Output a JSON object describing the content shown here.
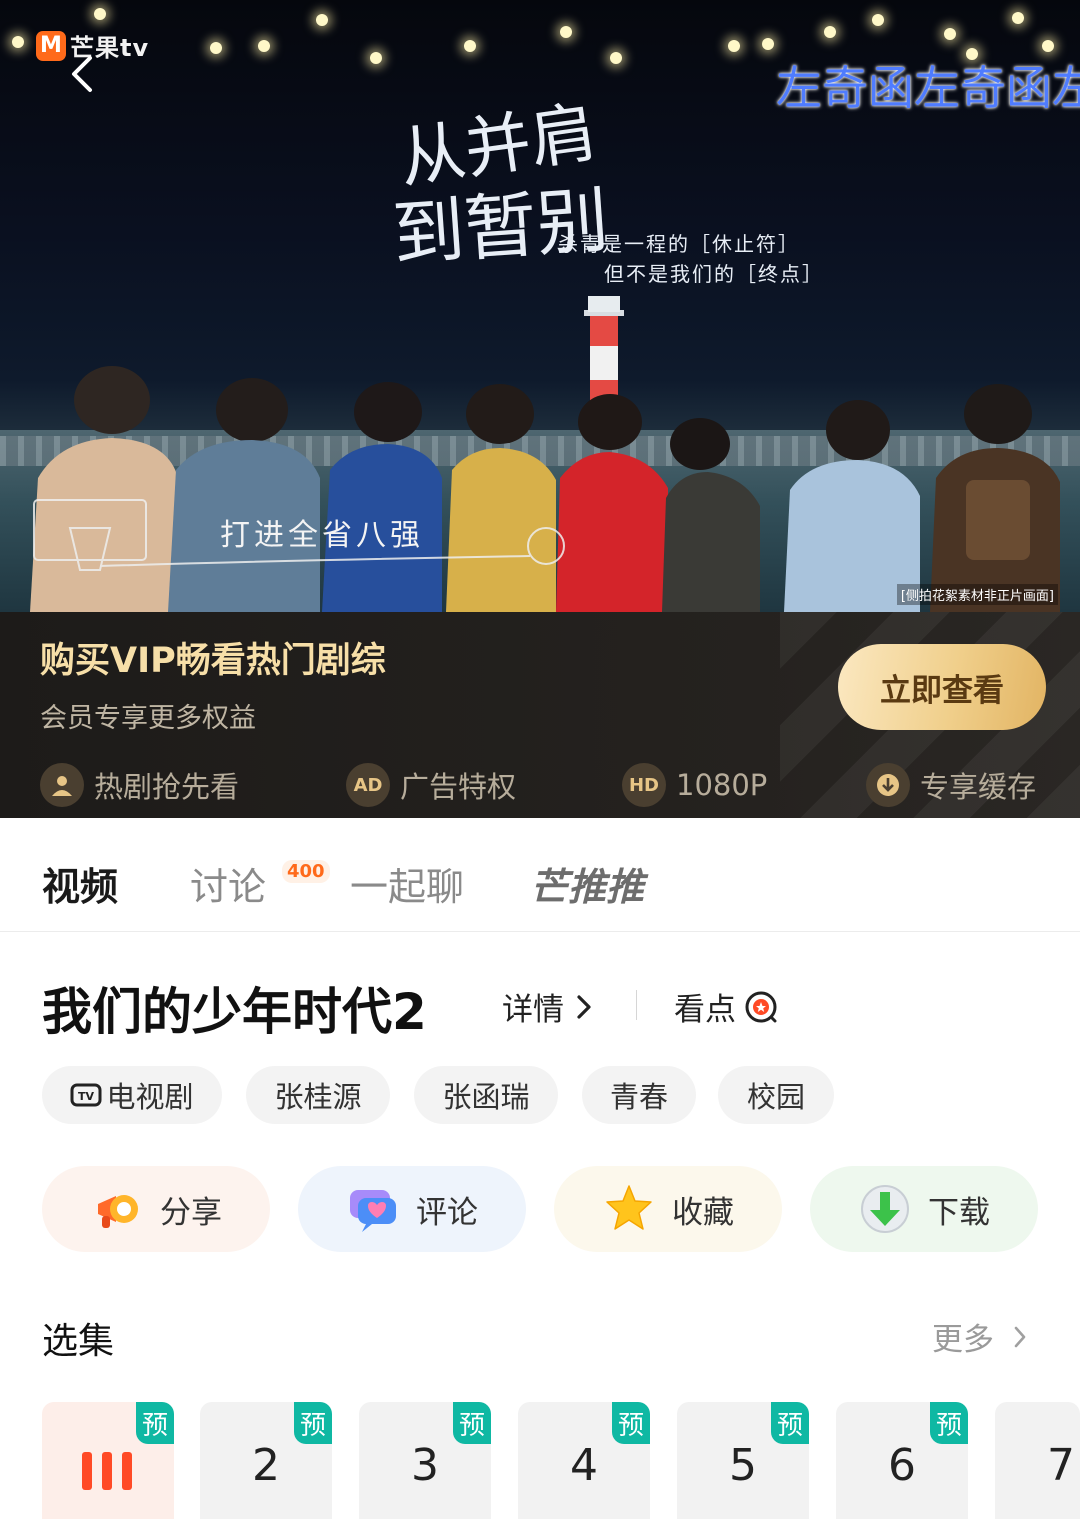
{
  "player": {
    "logo_text": "芒果tv",
    "marquee": "左奇函左奇函左",
    "calligraphy_line1": "从并肩",
    "calligraphy_line2": "到暂别",
    "calligraphy_sub1": "杀青是一程的［休止符］",
    "calligraphy_sub2": "但不是我们的［终点］",
    "caption": "打进全省八强",
    "watermark": "[侧拍花絮素材非正片画面]"
  },
  "vip": {
    "title": "购买VIP畅看热门剧综",
    "subtitle": "会员专享更多权益",
    "cta": "立即查看",
    "perks": [
      {
        "label": "热剧抢先看",
        "icon": "crown-user-icon"
      },
      {
        "label": "广告特权",
        "icon": "ad-free-icon"
      },
      {
        "label": "1080P",
        "icon": "hd-icon",
        "icon_text": "HD"
      },
      {
        "label": "专享缓存",
        "icon": "download-icon"
      }
    ]
  },
  "tabs": [
    {
      "label": "视频",
      "active": true
    },
    {
      "label": "讨论",
      "badge": "400"
    },
    {
      "label": "一起聊"
    },
    {
      "label": "芒推推"
    }
  ],
  "show": {
    "title": "我们的少年时代2",
    "detail_label": "详情",
    "highlights_label": "看点"
  },
  "tags": [
    "电视剧",
    "张桂源",
    "张函瑞",
    "青春",
    "校园"
  ],
  "actions": [
    {
      "label": "分享",
      "icon": "megaphone-icon"
    },
    {
      "label": "评论",
      "icon": "chat-heart-icon"
    },
    {
      "label": "收藏",
      "icon": "star-icon"
    },
    {
      "label": "下载",
      "icon": "download-arrow-icon"
    }
  ],
  "episodes": {
    "section_title": "选集",
    "more_label": "更多",
    "badge_label": "预",
    "items": [
      "",
      "2",
      "3",
      "4",
      "5",
      "6",
      "7"
    ]
  },
  "colors": {
    "vip_gold": "#f7dfa8",
    "accent_orange": "#ff6a1a",
    "badge_teal": "#0fb8a3",
    "marquee_blue": "#4f7cff"
  }
}
